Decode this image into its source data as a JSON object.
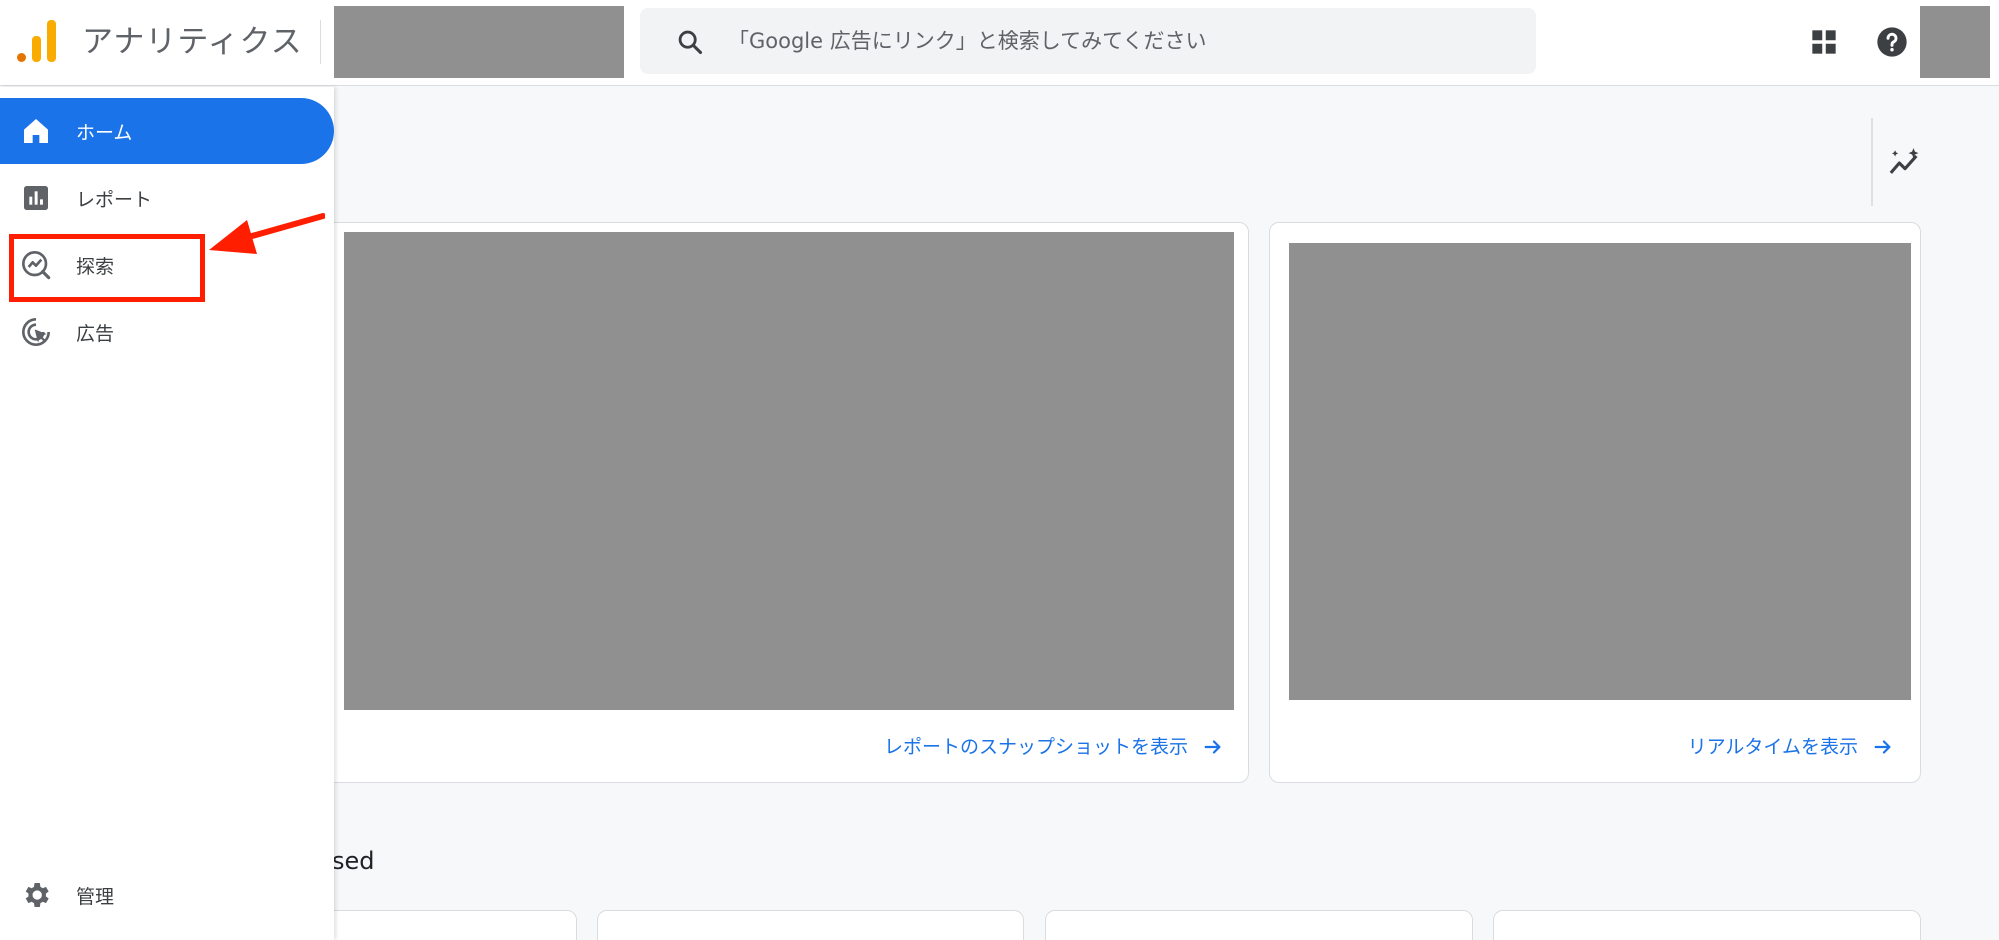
{
  "app": {
    "title": "アナリティクス"
  },
  "search": {
    "placeholder": "「Google 広告にリンク」と検索してみてください"
  },
  "sidebar": {
    "items": [
      {
        "label": "ホーム",
        "icon": "home-icon",
        "active": true
      },
      {
        "label": "レポート",
        "icon": "bar-chart-icon",
        "active": false
      },
      {
        "label": "探索",
        "icon": "explore-icon",
        "active": false
      },
      {
        "label": "広告",
        "icon": "advertising-icon",
        "active": false
      }
    ],
    "admin_label": "管理"
  },
  "cards": {
    "snapshot_link": "レポートのスナップショットを表示",
    "realtime_link": "リアルタイムを表示"
  },
  "section": {
    "title_partial": "sed"
  },
  "annotation": {
    "highlight_color": "#ff1f00"
  },
  "colors": {
    "accent": "#1a73e8",
    "logo_orange": "#f9ab00",
    "logo_dark_orange": "#e37400",
    "redaction": "#909090"
  }
}
